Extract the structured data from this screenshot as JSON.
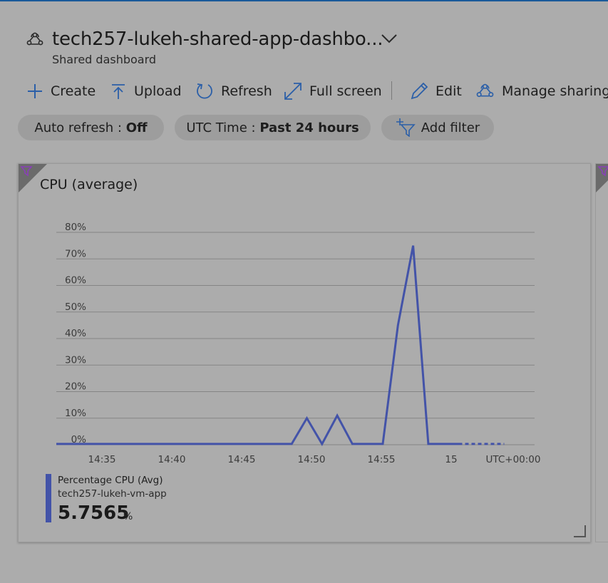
{
  "header": {
    "title": "tech257-lukeh-shared-app-dashbo...",
    "subtitle": "Shared dashboard"
  },
  "commands": {
    "create": "Create",
    "upload": "Upload",
    "refresh": "Refresh",
    "fullscreen": "Full screen",
    "edit": "Edit",
    "manage_sharing": "Manage sharing"
  },
  "filters": {
    "auto_refresh_label": "Auto refresh :",
    "auto_refresh_value": "Off",
    "time_label": "UTC Time :",
    "time_value": "Past 24 hours",
    "add_filter": "Add filter"
  },
  "tile": {
    "title": "CPU (average)",
    "legend": {
      "metric": "Percentage CPU (Avg)",
      "resource": "tech257-lukeh-vm-app",
      "value": "5.7565",
      "unit": "%"
    }
  },
  "chart_data": {
    "type": "line",
    "y_ticks": [
      "80%",
      "70%",
      "60%",
      "50%",
      "40%",
      "30%",
      "20%",
      "10%",
      "0%"
    ],
    "ylim": [
      0,
      80
    ],
    "x_ticks": [
      "14:35",
      "14:40",
      "14:45",
      "14:50",
      "14:55",
      "15",
      "UTC+00:00"
    ],
    "series": [
      {
        "name": "Percentage CPU (Avg)",
        "color": "#4353a8",
        "points": [
          {
            "x": "14:34",
            "y": 0.3
          },
          {
            "x": "14:49.5",
            "y": 0.3
          },
          {
            "x": "14:50.5",
            "y": 10
          },
          {
            "x": "14:51.5",
            "y": 0.3
          },
          {
            "x": "14:52.5",
            "y": 11
          },
          {
            "x": "14:53.5",
            "y": 0.3
          },
          {
            "x": "14:55.5",
            "y": 0.3
          },
          {
            "x": "14:56.5",
            "y": 45
          },
          {
            "x": "14:57.5",
            "y": 75
          },
          {
            "x": "14:58.5",
            "y": 0.3
          },
          {
            "x": "15:00.5",
            "y": 0.3
          }
        ],
        "projected": [
          {
            "x": "15:00.5",
            "y": 0.3
          },
          {
            "x": "15:03.5",
            "y": 0.3
          }
        ]
      }
    ],
    "grid": true
  },
  "colors": {
    "line": "#4353a8",
    "background": "#acacac",
    "filter_corner": "#6b6b6b",
    "filter_icon": "#8a3fb8"
  }
}
